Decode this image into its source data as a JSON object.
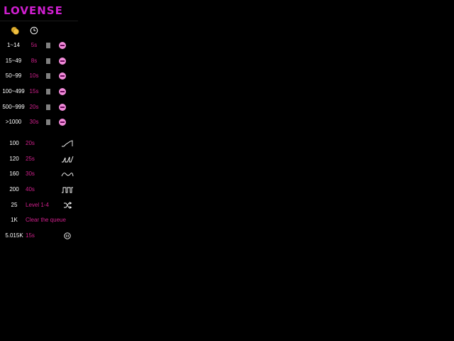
{
  "brand": {
    "logo_text": "LOVENSE",
    "accent_color": "#d01fd0",
    "duration_color": "#d0208c"
  },
  "header_icons": [
    "coins-icon",
    "clock-icon"
  ],
  "tip_levels": [
    {
      "range": "1~14",
      "duration": "5s",
      "level_icon": "level-icon"
    },
    {
      "range": "15~49",
      "duration": "8s",
      "level_icon": "level-icon"
    },
    {
      "range": "50~99",
      "duration": "10s",
      "level_icon": "level-icon"
    },
    {
      "range": "100~499",
      "duration": "15s",
      "level_icon": "level-icon"
    },
    {
      "range": "500~999",
      "duration": "20s",
      "level_icon": "level-icon"
    },
    {
      "range": ">1000",
      "duration": "30s",
      "level_icon": "level-icon"
    }
  ],
  "special_commands": [
    {
      "amount": "100",
      "description": "20s",
      "icon": "wave-pattern-icon"
    },
    {
      "amount": "120",
      "description": "25s",
      "icon": "pulse-pattern-icon"
    },
    {
      "amount": "160",
      "description": "30s",
      "icon": "sine-pattern-icon"
    },
    {
      "amount": "200",
      "description": "40s",
      "icon": "square-pattern-icon"
    },
    {
      "amount": "25",
      "description": "Level 1-4",
      "icon": "random-shuffle-icon"
    },
    {
      "amount": "1K",
      "description": "Clear the queue",
      "icon": ""
    },
    {
      "amount": "5.015K",
      "description": "15s",
      "icon": "pause-icon"
    }
  ]
}
